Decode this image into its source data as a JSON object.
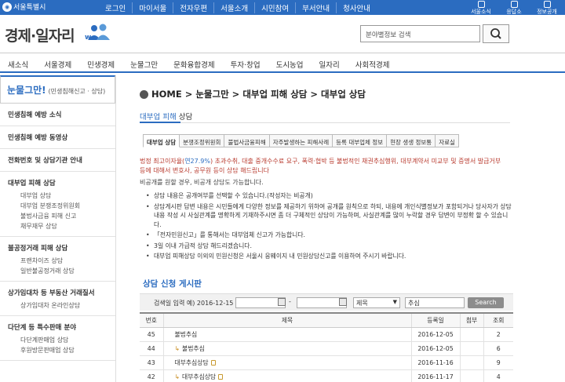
{
  "topbar": {
    "logo": "서울특별시",
    "menu": [
      "로그인",
      "마이서울",
      "전자우편",
      "서울소개",
      "시민참여",
      "부서안내",
      "청사안내"
    ],
    "quick": [
      "서울소식",
      "응답소",
      "정보공개"
    ]
  },
  "header": {
    "title": "경제·일자리",
    "search_placeholder": "분야별정보 검색"
  },
  "nav": [
    "새소식",
    "서울경제",
    "민생경제",
    "눈물그만",
    "문화융합경제",
    "투자·창업",
    "도시농업",
    "일자리",
    "사회적경제"
  ],
  "sidebar": {
    "head_main": "눈물그만!",
    "head_sub": "(민생침해신고 · 상담)",
    "items": [
      {
        "label": "민생침해 예방 소식",
        "subs": []
      },
      {
        "label": "민생침해 예방 동영상",
        "subs": []
      },
      {
        "label": "전화번호 및 상담기관 안내",
        "subs": []
      },
      {
        "label": "대부업 피해 상담",
        "subs": [
          "대부업 상담",
          "대부업 분쟁조정위원회",
          "불법사금융 피해 신고",
          "채무재무 상담"
        ]
      },
      {
        "label": "불공정거래 피해 상담",
        "subs": [
          "프랜차이즈 상담",
          "일반불공정거래 상담"
        ]
      },
      {
        "label": "상가임대차 등 부동산 거래질서",
        "subs": [
          "상가임대차 온라인상담"
        ]
      },
      {
        "label": "다단계 등 특수판매 분야",
        "subs": [
          "다단계판매업 상담",
          "후원방문판매업 상담"
        ]
      }
    ]
  },
  "breadcrumb": [
    "HOME",
    ">",
    "눈물그만",
    ">",
    "대부업 피해 상담",
    ">",
    "대부업 상담"
  ],
  "page_head": {
    "highlight": "대부업 피해",
    "rest": " 상담"
  },
  "subtabs": [
    "대부업 상담",
    "분쟁조정위원회",
    "불법사금융피해",
    "자주발생하는 피해사례",
    "등록 대부업체 정보",
    "현장 생생 정보통",
    "자료실"
  ],
  "notice": {
    "red_pre": "법정 최고이자율(",
    "red_rate": "연27.9%",
    "red_post": ") 초과수취, 대출 중개수수료 요구, 폭력·협박 등 불법적인 채권추심행위, 대부계약서 미교부 및 증명서 발급거부 등에 대해서 변호사, 공무원 등이 상담 해드립니다",
    "plain": "비공개를 원할 경우, 비공개 상담도 가능합니다.",
    "bullets": [
      "상담 내용은 공개여부를 선택할 수 있습니다.(작성자는 비공개)",
      "상담게시판 답변 내용은 시민들에게 다양한 정보를 제공하기 위하여 공개를 원칙으로 하되, 내용에 개인식별정보가 포함되거나 당사자가 상담내용 작성 시 사실관계를 명확하게 기재하주시면 좀 더 구체적인 상담이 가능하며, 사실관계를 많이 누락할 경우 답변이 부정확 할 수 있습니다.",
      "「전자민원신고」를 통해서는 대부업체 신고가 가능합니다.",
      "3일 이내 가급적 상담 해드리겠습니다.",
      "대부업 피해상담 이외의 민원신청은 서울시 응뭬이지 내 민원상담신고를 이용하여 주시기 바랍니다."
    ]
  },
  "board": {
    "title": "상담 신청 게시판",
    "filter_label": "검색일 입력 예) 2016-12-15",
    "date_sep": "-",
    "select_value": "제목",
    "keyword": "추심",
    "search_button": "Search",
    "columns": [
      "번호",
      "제목",
      "등록일",
      "첨부",
      "조회"
    ],
    "rows": [
      {
        "no": "45",
        "reply": false,
        "title": "불법추심",
        "date": "2016-12-05",
        "attach": "",
        "views": "2",
        "lock": false
      },
      {
        "no": "44",
        "reply": true,
        "title": "불법추심",
        "date": "2016-12-05",
        "attach": "",
        "views": "6",
        "lock": false
      },
      {
        "no": "43",
        "reply": false,
        "title": "대부추심상담",
        "date": "2016-11-16",
        "attach": "",
        "views": "9",
        "lock": true
      },
      {
        "no": "42",
        "reply": true,
        "title": "대부추심상담",
        "date": "2016-11-17",
        "attach": "",
        "views": "4",
        "lock": true
      }
    ]
  }
}
